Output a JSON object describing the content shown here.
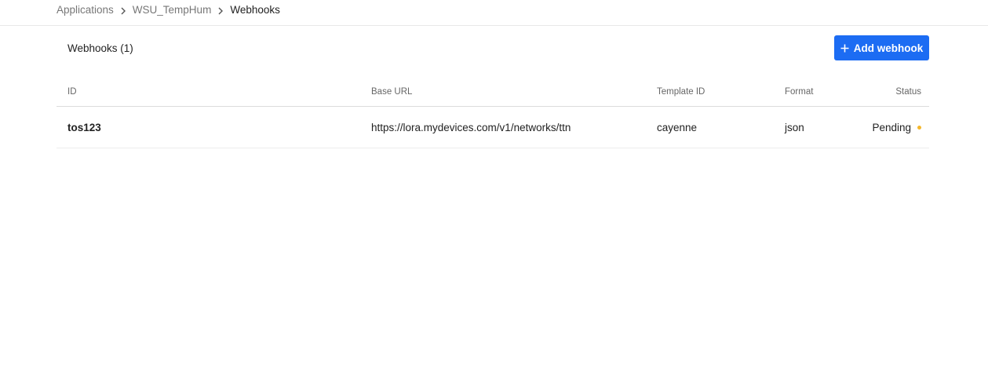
{
  "breadcrumb": {
    "items": [
      "Applications",
      "WSU_TempHum"
    ],
    "current": "Webhooks"
  },
  "panel": {
    "title": "Webhooks (1)",
    "add_button_label": "Add webhook"
  },
  "table": {
    "columns": [
      "ID",
      "Base URL",
      "Template ID",
      "Format",
      "Status"
    ],
    "rows": [
      {
        "id": "tos123",
        "base_url": "https://lora.mydevices.com/v1/networks/ttn",
        "template_id": "cayenne",
        "format": "json",
        "status": "Pending"
      }
    ]
  },
  "colors": {
    "accent": "#1c6cf3",
    "status_pending": "#f5b72b"
  },
  "icons": [
    "chevron-right-icon",
    "plus-icon",
    "status-dot-icon"
  ]
}
